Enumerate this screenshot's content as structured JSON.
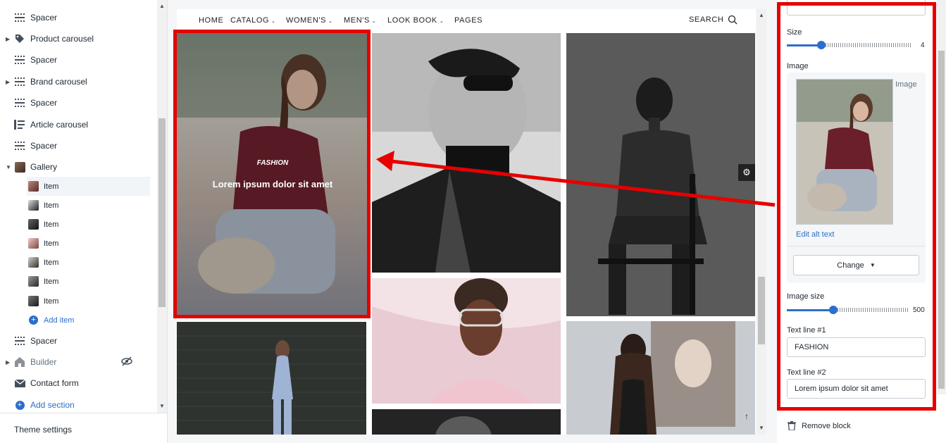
{
  "sidebar": {
    "items": [
      {
        "label": "Spacer",
        "icon": "spacer-icon"
      },
      {
        "label": "Product carousel",
        "icon": "tag-icon"
      },
      {
        "label": "Spacer",
        "icon": "spacer-icon"
      },
      {
        "label": "Brand carousel",
        "icon": "spacer-icon"
      },
      {
        "label": "Spacer",
        "icon": "spacer-icon"
      },
      {
        "label": "Article carousel",
        "icon": "article-icon"
      },
      {
        "label": "Spacer",
        "icon": "spacer-icon"
      },
      {
        "label": "Gallery",
        "icon": "gallery-thumb"
      }
    ],
    "gallery_items": [
      "Item",
      "Item",
      "Item",
      "Item",
      "Item",
      "Item",
      "Item"
    ],
    "add_item": "Add item",
    "after": [
      {
        "label": "Spacer",
        "icon": "spacer-icon"
      },
      {
        "label": "Builder",
        "icon": "builder-icon"
      },
      {
        "label": "Contact form",
        "icon": "mail-icon"
      }
    ],
    "add_section": "Add section",
    "theme_settings": "Theme settings"
  },
  "preview": {
    "nav": [
      "HOME",
      "CATALOG",
      "WOMEN'S",
      "MEN'S",
      "LOOK BOOK",
      "PAGES"
    ],
    "search": "SEARCH",
    "tile_caption_small": "FASHION",
    "tile_caption_large": "Lorem ipsum dolor sit amet"
  },
  "panel": {
    "size_label": "Size",
    "size_value": "4",
    "size_fraction": 0.28,
    "image_label": "Image",
    "image_caption": "Image",
    "edit_alt": "Edit alt text",
    "change": "Change",
    "image_size_label": "Image size",
    "image_size_value": "500",
    "image_size_fraction": 0.38,
    "text1_label": "Text line #1",
    "text1_value": "FASHION",
    "text2_label": "Text line #2",
    "text2_value": "Lorem ipsum dolor sit amet",
    "remove_block": "Remove block"
  },
  "colors": {
    "accent": "#2c6ecb",
    "highlight": "#e60000"
  }
}
